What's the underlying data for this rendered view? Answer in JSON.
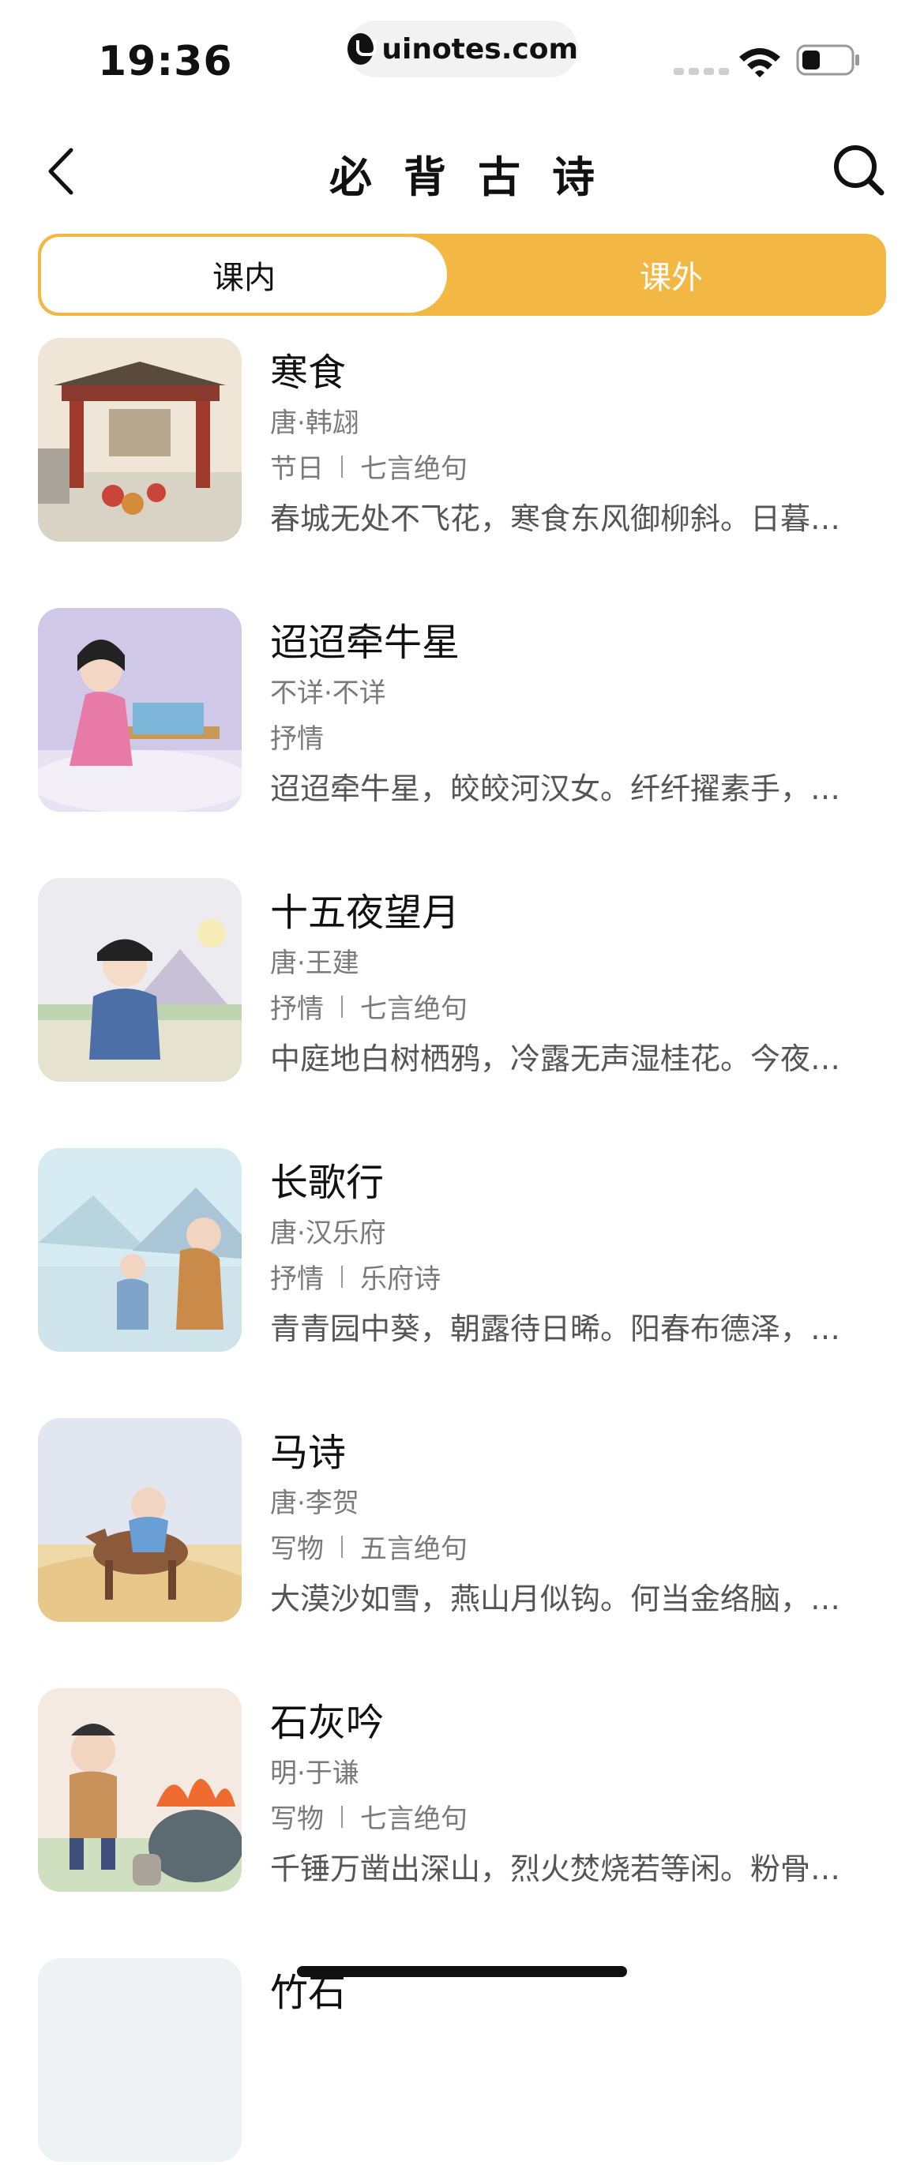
{
  "status_bar": {
    "time": "19:36",
    "url": "uinotes.com",
    "icons": [
      "signal-icon",
      "wifi-icon",
      "battery-icon"
    ]
  },
  "nav": {
    "title": "必背古诗",
    "back_icon": "chevron-left-icon",
    "search_icon": "search-icon"
  },
  "tabs": {
    "selected": "课内",
    "items": [
      "课内",
      "课外"
    ],
    "accent": "#f2b843"
  },
  "poems": [
    {
      "title": "寒食",
      "author": "唐·韩翃",
      "tags": [
        "节日",
        "七言绝句"
      ],
      "excerpt": "春城无处不飞花，寒食东风御柳斜。日暮汉宫传蜡烛，轻烟散入五侯家。"
    },
    {
      "title": "迢迢牵牛星",
      "author": "不详·不详",
      "tags": [
        "抒情"
      ],
      "excerpt": "迢迢牵牛星，皎皎河汉女。纤纤擢素手，札札弄机杼。"
    },
    {
      "title": "十五夜望月",
      "author": "唐·王建",
      "tags": [
        "抒情",
        "七言绝句"
      ],
      "excerpt": "中庭地白树栖鸦，冷露无声湿桂花。今夜月明人尽望，不知秋思落谁家。"
    },
    {
      "title": "长歌行",
      "author": "唐·汉乐府",
      "tags": [
        "抒情",
        "乐府诗"
      ],
      "excerpt": "青青园中葵，朝露待日晞。阳春布德泽，万物生光辉。"
    },
    {
      "title": "马诗",
      "author": "唐·李贺",
      "tags": [
        "写物",
        "五言绝句"
      ],
      "excerpt": "大漠沙如雪，燕山月似钩。何当金络脑，快走踏清秋。"
    },
    {
      "title": "石灰吟",
      "author": "明·于谦",
      "tags": [
        "写物",
        "七言绝句"
      ],
      "excerpt": "千锤万凿出深山，烈火焚烧若等闲。粉骨碎身浑不怕，要留清白在人间。"
    },
    {
      "title": "竹石",
      "author": "",
      "tags": [],
      "excerpt": ""
    }
  ]
}
